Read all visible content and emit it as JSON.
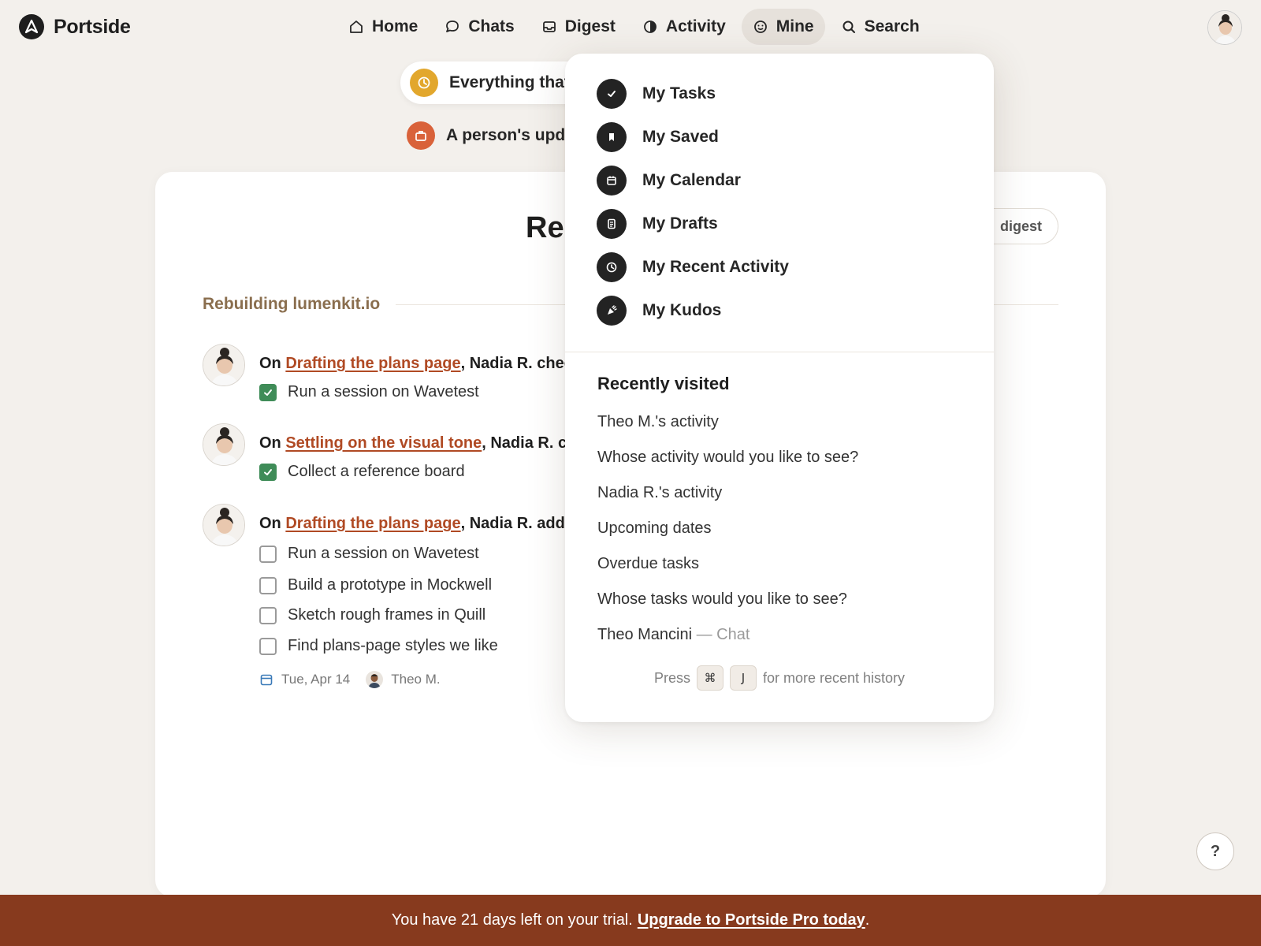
{
  "app": {
    "name": "Portside"
  },
  "nav": {
    "items": [
      {
        "label": "Home",
        "icon": "home-icon"
      },
      {
        "label": "Chats",
        "icon": "chat-bubble-icon"
      },
      {
        "label": "Digest",
        "icon": "inbox-tray-icon"
      },
      {
        "label": "Activity",
        "icon": "half-circle-icon"
      },
      {
        "label": "Mine",
        "icon": "smiley-icon",
        "active": true
      },
      {
        "label": "Search",
        "icon": "search-icon"
      }
    ]
  },
  "pills": {
    "everything": "Everything that",
    "person": "A person's upda"
  },
  "card": {
    "title": "Rec",
    "digest_button": "digest",
    "section": "Rebuilding lumenkit.io"
  },
  "entries": [
    {
      "prefix": "On ",
      "link": "Drafting the plans page",
      "suffix": ", Nadia R. chec",
      "tasks": [
        {
          "label": "Run a session on Wavetest",
          "checked": true
        }
      ]
    },
    {
      "prefix": "On ",
      "link": "Settling on the visual tone",
      "suffix": ", Nadia R. cl",
      "tasks": [
        {
          "label": "Collect a reference board",
          "checked": true
        }
      ]
    },
    {
      "prefix": "On ",
      "link": "Drafting the plans page",
      "suffix": ", Nadia R. adde",
      "tasks": [
        {
          "label": "Run a session on Wavetest",
          "checked": false
        },
        {
          "label": "Build a prototype in Mockwell",
          "checked": false
        },
        {
          "label": "Sketch rough frames in Quill",
          "checked": false
        },
        {
          "label": "Find plans-page styles we like",
          "checked": false
        }
      ],
      "meta": {
        "date": "Tue, Apr 14",
        "assignee": "Theo M."
      }
    }
  ],
  "dropdown": {
    "items": [
      {
        "label": "My Tasks",
        "icon": "check-icon"
      },
      {
        "label": "My Saved",
        "icon": "bookmark-icon"
      },
      {
        "label": "My Calendar",
        "icon": "calendar-icon"
      },
      {
        "label": "My Drafts",
        "icon": "document-icon"
      },
      {
        "label": "My Recent Activity",
        "icon": "clock-icon"
      },
      {
        "label": "My Kudos",
        "icon": "party-popper-icon"
      }
    ],
    "recent_title": "Recently visited",
    "recent": [
      {
        "label": "Theo M.'s activity"
      },
      {
        "label": "Whose activity would you like to see?"
      },
      {
        "label": "Nadia R.'s activity"
      },
      {
        "label": "Upcoming dates"
      },
      {
        "label": "Overdue tasks"
      },
      {
        "label": "Whose tasks would you like to see?"
      },
      {
        "label": "Theo Mancini",
        "sub": " — Chat"
      }
    ],
    "hint": {
      "press": "Press",
      "key1": "⌘",
      "key2": "J",
      "rest": "for more recent history"
    }
  },
  "help": {
    "label": "?"
  },
  "banner": {
    "text": "You have 21 days left on your trial.",
    "link": "Upgrade to Portside Pro today",
    "end": "."
  },
  "colors": {
    "background": "#f3f0ec",
    "link": "#b04a24",
    "checked": "#3f8c58",
    "banner": "#873a1e",
    "section": "#8a6e4e"
  }
}
